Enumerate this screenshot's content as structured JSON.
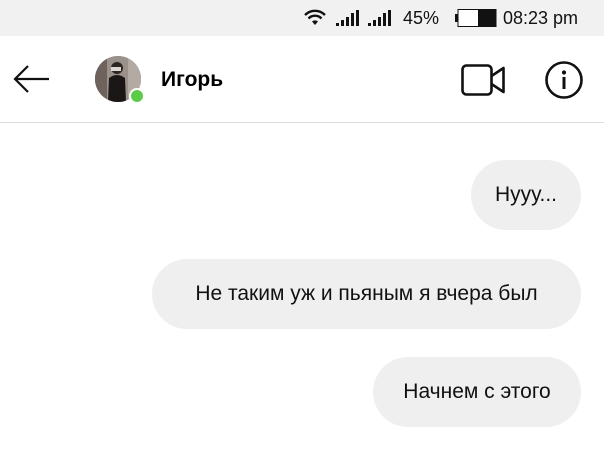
{
  "status_bar": {
    "battery_percent": "45%",
    "battery_level": 0.45,
    "time": "08:23 pm",
    "icons": [
      "wifi-icon",
      "signal-icon",
      "signal-icon",
      "battery-icon"
    ]
  },
  "header": {
    "contact_name": "Игорь",
    "online": true,
    "online_color": "#5ccc48",
    "icons": [
      "back-arrow-icon",
      "avatar",
      "video-call-icon",
      "info-icon"
    ]
  },
  "messages": [
    {
      "text": "Нууу...",
      "direction": "outgoing"
    },
    {
      "text": "Не таким уж и пьяным я вчера был",
      "direction": "outgoing"
    },
    {
      "text": "Начнем с этого",
      "direction": "outgoing"
    }
  ],
  "colors": {
    "status_bar_bg": "#f1f1f1",
    "bubble_bg": "#efefef",
    "header_divider": "#dcdcdc"
  }
}
